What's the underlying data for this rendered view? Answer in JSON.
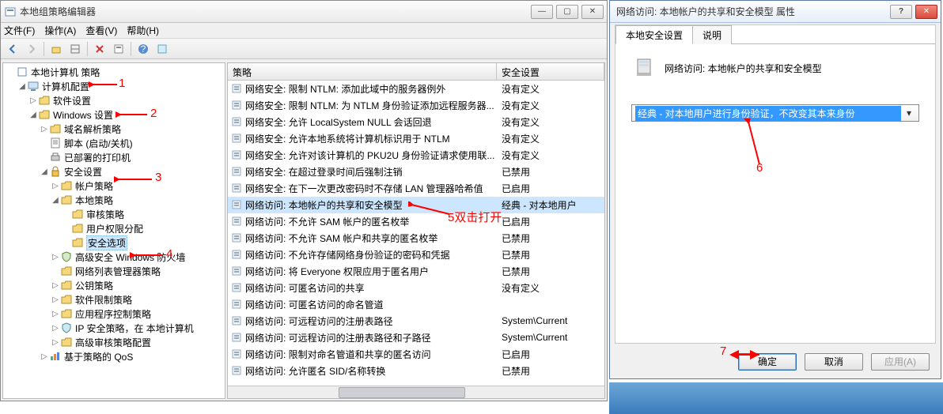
{
  "gpedit": {
    "title": "本地组策略编辑器",
    "menu": {
      "file": "文件(F)",
      "action": "操作(A)",
      "view": "查看(V)",
      "help": "帮助(H)"
    },
    "tree": {
      "root": "本地计算机 策略",
      "computer": "计算机配置",
      "software": "软件设置",
      "windows": "Windows 设置",
      "dns": "域名解析策略",
      "scripts": "脚本 (启动/关机)",
      "printers": "已部署的打印机",
      "security": "安全设置",
      "account": "帐户策略",
      "local_pol": "本地策略",
      "audit": "审核策略",
      "rights": "用户权限分配",
      "options": "安全选项",
      "wfas": "高级安全 Windows 防火墙",
      "nlm": "网络列表管理器策略",
      "pk": "公钥策略",
      "srp": "软件限制策略",
      "acp": "应用程序控制策略",
      "ipsec": "IP 安全策略，在 本地计算机",
      "adv_audit": "高级审核策略配置",
      "qos": "基于策略的 QoS"
    },
    "list": {
      "columns": {
        "policy": "策略",
        "setting": "安全设置"
      },
      "rows": [
        {
          "p": "网络安全: 限制 NTLM: 添加此域中的服务器例外",
          "s": "没有定义"
        },
        {
          "p": "网络安全: 限制 NTLM: 为 NTLM 身份验证添加远程服务器...",
          "s": "没有定义"
        },
        {
          "p": "网络安全: 允许 LocalSystem NULL 会话回退",
          "s": "没有定义"
        },
        {
          "p": "网络安全: 允许本地系统将计算机标识用于 NTLM",
          "s": "没有定义"
        },
        {
          "p": "网络安全: 允许对该计算机的 PKU2U 身份验证请求使用联...",
          "s": "没有定义"
        },
        {
          "p": "网络安全: 在超过登录时间后强制注销",
          "s": "已禁用"
        },
        {
          "p": "网络安全: 在下一次更改密码时不存储 LAN 管理器哈希值",
          "s": "已启用"
        },
        {
          "p": "网络访问: 本地帐户的共享和安全模型",
          "s": "经典 - 对本地用户"
        },
        {
          "p": "网络访问: 不允许 SAM 帐户的匿名枚举",
          "s": "已启用"
        },
        {
          "p": "网络访问: 不允许 SAM 帐户和共享的匿名枚举",
          "s": "已禁用"
        },
        {
          "p": "网络访问: 不允许存储网络身份验证的密码和凭据",
          "s": "已禁用"
        },
        {
          "p": "网络访问: 将 Everyone 权限应用于匿名用户",
          "s": "已禁用"
        },
        {
          "p": "网络访问: 可匿名访问的共享",
          "s": "没有定义"
        },
        {
          "p": "网络访问: 可匿名访问的命名管道",
          "s": ""
        },
        {
          "p": "网络访问: 可远程访问的注册表路径",
          "s": "System\\Current"
        },
        {
          "p": "网络访问: 可远程访问的注册表路径和子路径",
          "s": "System\\Current"
        },
        {
          "p": "网络访问: 限制对命名管道和共享的匿名访问",
          "s": "已启用"
        },
        {
          "p": "网络访问: 允许匿名 SID/名称转换",
          "s": "已禁用"
        }
      ],
      "selected_index": 7
    }
  },
  "dialog": {
    "title": "网络访问: 本地帐户的共享和安全模型 属性",
    "tabs": {
      "local": "本地安全设置",
      "desc": "说明"
    },
    "heading": "网络访问: 本地帐户的共享和安全模型",
    "combo_value": "经典 - 对本地用户进行身份验证，不改变其本来身份",
    "buttons": {
      "ok": "确定",
      "cancel": "取消",
      "apply": "应用(A)"
    }
  },
  "anno": {
    "a1": "1",
    "a2": "2",
    "a3": "3",
    "a4": "4",
    "a5": "5双击打开",
    "a6": "6",
    "a7": "7"
  }
}
